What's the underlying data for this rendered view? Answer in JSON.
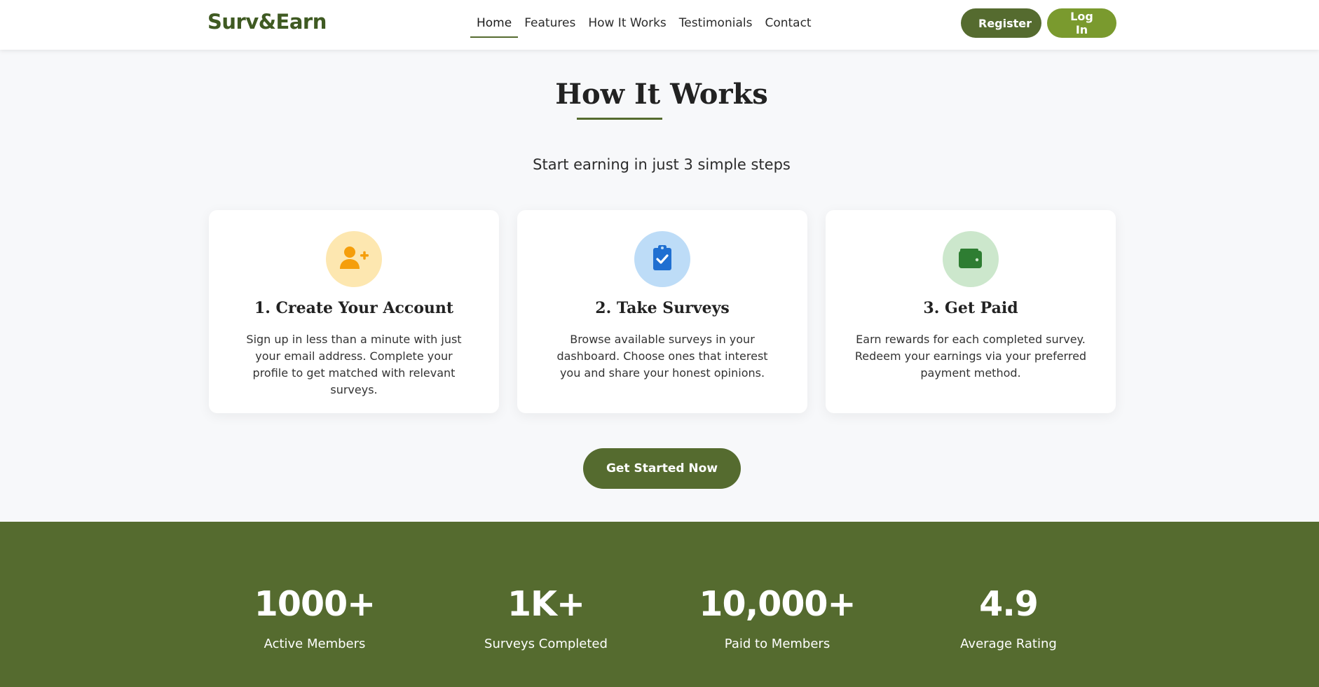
{
  "brand": "Surv&Earn",
  "nav": {
    "links": [
      "Home",
      "Features",
      "How It Works",
      "Testimonials",
      "Contact"
    ],
    "active": "Home",
    "register_label": "Register",
    "login_label": "Log In"
  },
  "how_it_works": {
    "title": "How It Works",
    "subtitle": "Start earning in just 3 simple steps",
    "steps": [
      {
        "title": "1. Create Your Account",
        "description": "Sign up in less than a minute with just your email address. Complete your profile to get matched with relevant surveys.",
        "icon": "user-plus-icon",
        "icon_color": "#f59e0b",
        "circle_color": "#fde7b0"
      },
      {
        "title": "2. Take Surveys",
        "description": "Browse available surveys in your dashboard. Choose ones that interest you and share your honest opinions.",
        "icon": "clipboard-check-icon",
        "icon_color": "#1f6fd1",
        "circle_color": "#bddcf7"
      },
      {
        "title": "3. Get Paid",
        "description": "Earn rewards for each completed survey. Redeem your earnings via your preferred payment method.",
        "icon": "wallet-icon",
        "icon_color": "#2e7d32",
        "circle_color": "#cce7cc"
      }
    ],
    "cta_label": "Get Started Now"
  },
  "stats": [
    {
      "value": "1000+",
      "label": "Active Members"
    },
    {
      "value": "1K+",
      "label": "Surveys Completed"
    },
    {
      "value": "10,000+",
      "label": "Paid to Members"
    },
    {
      "value": "4.9",
      "label": "Average Rating"
    }
  ],
  "colors": {
    "brand": "#3f5a22",
    "primary": "#556b2f",
    "login": "#7a9a2e",
    "page_bg": "#f7f8fa"
  }
}
